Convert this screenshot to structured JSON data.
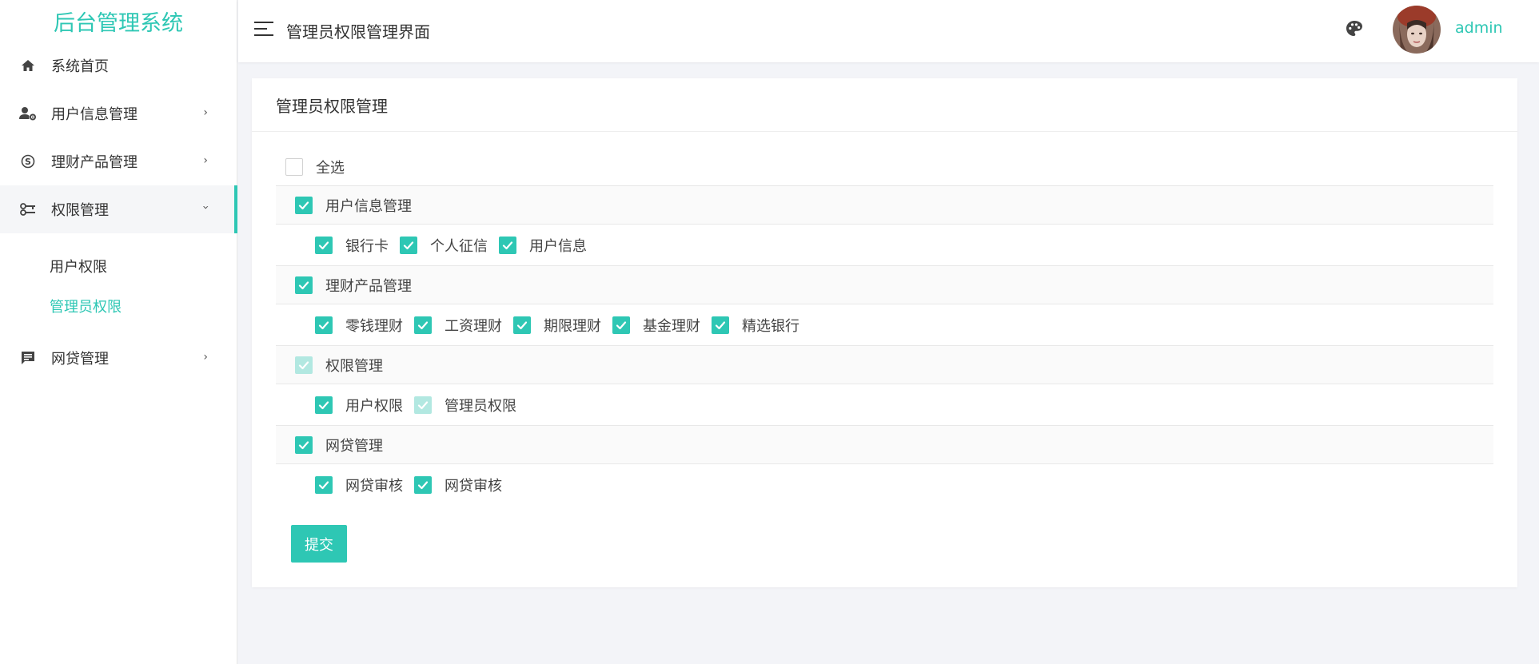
{
  "app": {
    "title": "后台管理系统"
  },
  "colors": {
    "accent": "#2ec7b4",
    "disabled": "#b2e8e1"
  },
  "sidebar": {
    "items": [
      {
        "label": "系统首页",
        "icon": "home-icon"
      },
      {
        "label": "用户信息管理",
        "icon": "user-settings-icon"
      },
      {
        "label": "理财产品管理",
        "icon": "skype-icon"
      },
      {
        "label": "权限管理",
        "icon": "key-icon",
        "expanded": true
      },
      {
        "label": "网贷管理",
        "icon": "message-icon"
      }
    ],
    "submenu": [
      {
        "label": "用户权限",
        "selected": false
      },
      {
        "label": "管理员权限",
        "selected": true
      }
    ]
  },
  "header": {
    "title": "管理员权限管理界面",
    "username": "admin"
  },
  "card": {
    "title": "管理员权限管理",
    "select_all": {
      "label": "全选",
      "state": "unchecked"
    },
    "groups": [
      {
        "label": "用户信息管理",
        "state": "checked",
        "children": [
          {
            "label": "银行卡",
            "state": "checked"
          },
          {
            "label": "个人征信",
            "state": "checked"
          },
          {
            "label": "用户信息",
            "state": "checked"
          }
        ]
      },
      {
        "label": "理财产品管理",
        "state": "checked",
        "children": [
          {
            "label": "零钱理财",
            "state": "checked"
          },
          {
            "label": "工资理财",
            "state": "checked"
          },
          {
            "label": "期限理财",
            "state": "checked"
          },
          {
            "label": "基金理财",
            "state": "checked"
          },
          {
            "label": "精选银行",
            "state": "checked"
          }
        ]
      },
      {
        "label": "权限管理",
        "state": "disabled",
        "children": [
          {
            "label": "用户权限",
            "state": "checked"
          },
          {
            "label": "管理员权限",
            "state": "disabled"
          }
        ]
      },
      {
        "label": "网贷管理",
        "state": "checked",
        "children": [
          {
            "label": "网贷审核",
            "state": "checked"
          },
          {
            "label": "网贷审核",
            "state": "checked"
          }
        ]
      }
    ],
    "submit_label": "提交"
  }
}
